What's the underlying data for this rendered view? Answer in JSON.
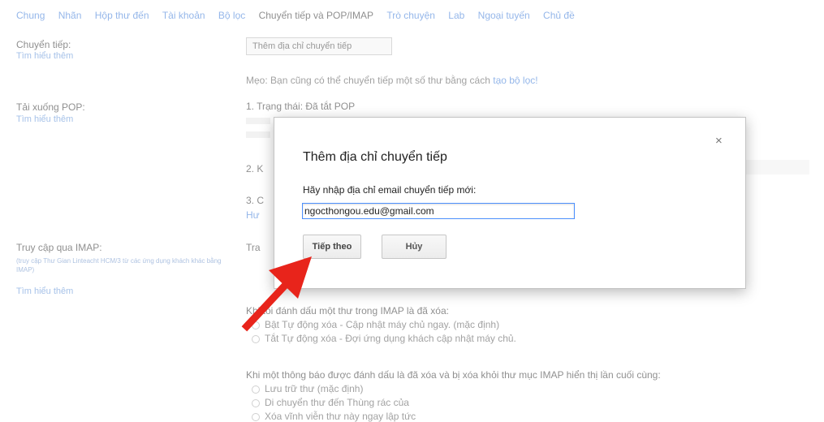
{
  "tabs": [
    "Chung",
    "Nhãn",
    "Hộp thư đến",
    "Tài khoản",
    "Bộ lọc",
    "Chuyển tiếp và POP/IMAP",
    "Trò chuyện",
    "Lab",
    "Ngoại tuyến",
    "Chủ đề"
  ],
  "forwarding": {
    "label": "Chuyển tiếp:",
    "learn_more": "Tìm hiểu thêm",
    "add_button": "Thêm địa chỉ chuyển tiếp",
    "tip": "Mẹo: Bạn cũng có thể chuyển tiếp một số thư bằng cách",
    "tip_link": "tạo bộ lọc!"
  },
  "pop": {
    "label": "Tải xuống POP:",
    "learn_more": "Tìm hiểu thêm",
    "status": "1. Trạng thái: Đã tắt POP",
    "step2": "2. K",
    "step3": "3. C",
    "step3b": "Hư"
  },
  "imap": {
    "label": "Truy cập qua IMAP:",
    "desc": "(truy cập Thư Gian Linteacht HCM/3 từ các ứng dụng khách khác bằng IMAP)",
    "learn_more": "Tìm hiểu thêm",
    "status_prefix": "Tra",
    "deleted_heading": "Khi tôi đánh dấu một thư trong IMAP là đã xóa:",
    "deleted_opt1": "Bật Tự động xóa - Cập nhật máy chủ ngay. (mặc định)",
    "deleted_opt2": "Tắt Tự động xóa - Đợi ứng dụng khách cập nhật máy chủ.",
    "expunge_heading": "Khi một thông báo được đánh dấu là đã xóa và bị xóa khỏi thư mục IMAP hiển thị lần cuối cùng:",
    "expunge_opt1": "Lưu trữ thư (mặc định)",
    "expunge_opt2": "Di chuyển thư đến Thùng rác của",
    "expunge_opt3": "Xóa vĩnh viễn thư này ngay lập tức"
  },
  "dialog": {
    "title": "Thêm địa chỉ chuyển tiếp",
    "close": "×",
    "prompt": "Hãy nhập địa chỉ email chuyển tiếp mới:",
    "email_value": "ngocthongou.edu@gmail.com",
    "next_button": "Tiếp theo",
    "cancel_button": "Hủy"
  },
  "colors": {
    "arrow": "#e8241b",
    "link": "#3d7bd8"
  }
}
